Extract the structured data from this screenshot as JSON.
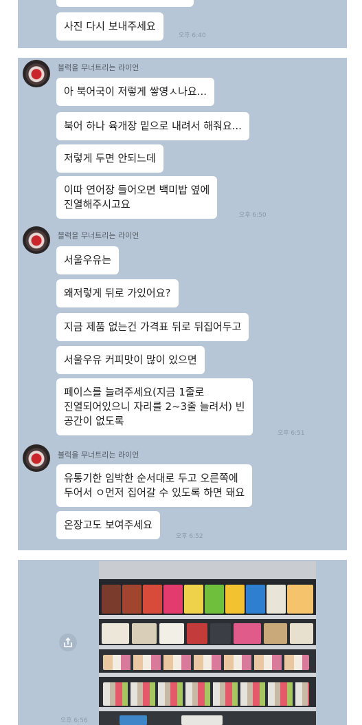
{
  "sender_name": "블럭을 무너트리는 라이언",
  "groups": [
    {
      "messages": [
        "사진 다시 보내주세요"
      ],
      "time": "오후 6:40"
    },
    {
      "messages": [
        "아 북어국이 저렇게 쌓영ㅅ나요...",
        "북어 하나 육개장 밑으로 내려서 해줘요...",
        "저렇게 두면 안되느데",
        "이따 연어장 들어오면 백미밥 옆에\n진열해주시고요"
      ],
      "time": "오후 6:50"
    },
    {
      "messages": [
        "서울우유는",
        "왜저렇게 뒤로 가있어요?",
        "지금 제품 없는건 가격표 뒤로 뒤집어두고",
        "서울우유 커피맛이 많이 있으면",
        "페이스를 늘려주세요(지금 1줄로\n진열되어있으니 자리를 2~3줄 늘려서) 빈\n공간이 없도록"
      ],
      "time": "오후 6:51"
    },
    {
      "messages": [
        "유통기한 임박한 순서대로 두고 오른쪽에\n두어서 ㅇ먼저 집어갈 수 있도록 하면 돼요",
        "온장고도 보여주세요"
      ],
      "time": "오후 6:52"
    }
  ],
  "photo_message": {
    "time": "오후 6:56",
    "share_icon": "share-icon",
    "image_subject": "convenience-store-fridge-photo"
  },
  "colors": {
    "chat_background": "#b6c6d7",
    "bubble": "#ffffff",
    "text": "#222222"
  }
}
